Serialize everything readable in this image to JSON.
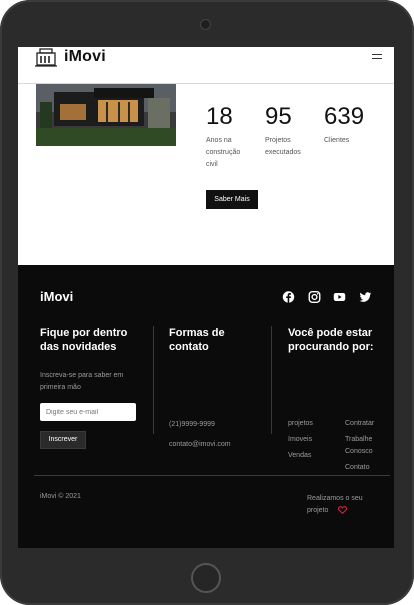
{
  "header": {
    "brand": "iMovi"
  },
  "stats": [
    {
      "number": "18",
      "label_lines": [
        "Anos na",
        "construção",
        "civil"
      ]
    },
    {
      "number": "95",
      "label_lines": [
        "Projetos",
        "executados"
      ]
    },
    {
      "number": "639",
      "label_lines": [
        "Clientes"
      ]
    }
  ],
  "about": {
    "more_button": "Saber Mais"
  },
  "footer": {
    "brand": "iMovi",
    "social_icons": [
      "facebook-icon",
      "instagram-icon",
      "youtube-icon",
      "twitter-icon"
    ],
    "newsletter": {
      "title_lines": [
        "Fique por dentro",
        "das novidades"
      ],
      "description_lines": [
        "Inscreva-se para saber em",
        "primeira mão"
      ],
      "email_placeholder": "Digite seu e-mail",
      "button": "Inscrever"
    },
    "contact": {
      "title_lines": [
        "Formas de",
        "contato"
      ],
      "phone": "(21)9999-9999",
      "email": "contato@imovi.com"
    },
    "looking_for": {
      "title_lines": [
        "Você pode estar",
        "procurando por:"
      ],
      "links_left": [
        "projetos",
        "Imoveis",
        "Vendas"
      ],
      "links_right": [
        "Contratar",
        "Trabalhe",
        "Conosco",
        "Contato"
      ]
    },
    "copyright": "iMovi © 2021",
    "made_with_lines": [
      "Realizamos o seu",
      "projeto"
    ],
    "heart_color": "#e0203a"
  }
}
